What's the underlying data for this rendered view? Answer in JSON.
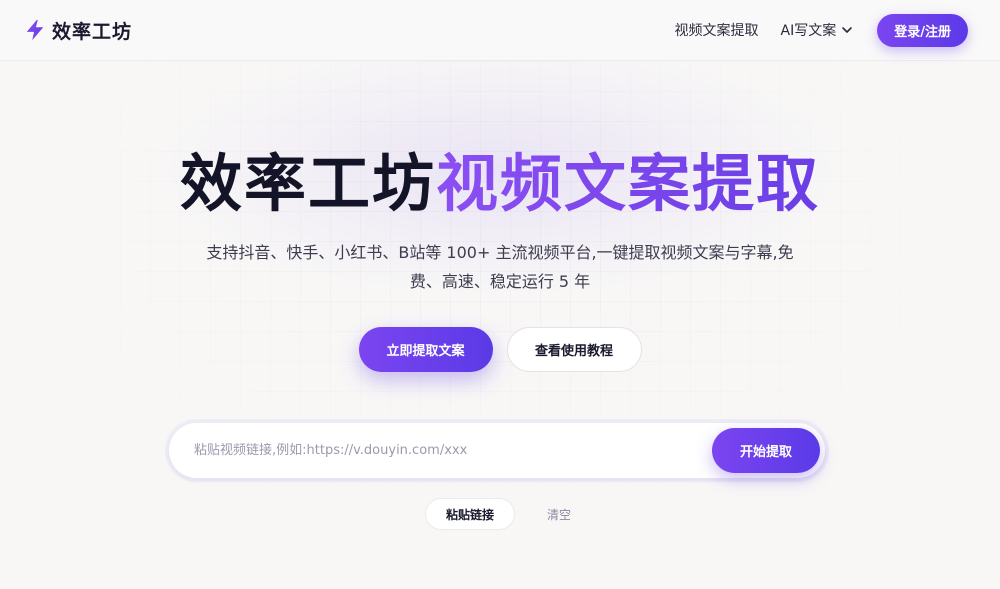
{
  "header": {
    "brand": "效率工坊",
    "brand_icon": "lightning-bolt-icon",
    "nav_video_extract": "视频文案提取",
    "nav_ai_write": "AI写文案",
    "login": "登录/注册"
  },
  "hero": {
    "title_part1": "效率工坊",
    "title_part2": "视频文案提取",
    "subtitle": "支持抖音、快手、小红书、B站等 100+ 主流视频平台,一键提取视频文案与字幕,免费、高速、稳定运行 5 年",
    "cta_primary": "立即提取文案",
    "cta_secondary": "查看使用教程"
  },
  "search": {
    "placeholder": "粘贴视频链接,例如:https://v.douyin.com/xxx",
    "value": "",
    "submit": "开始提取"
  },
  "tools": {
    "paste": "粘贴链接",
    "clear": "清空"
  },
  "colors": {
    "accent": "#6b3ee6",
    "accent_light": "#8b4ff2",
    "background": "#f8f7f6"
  }
}
